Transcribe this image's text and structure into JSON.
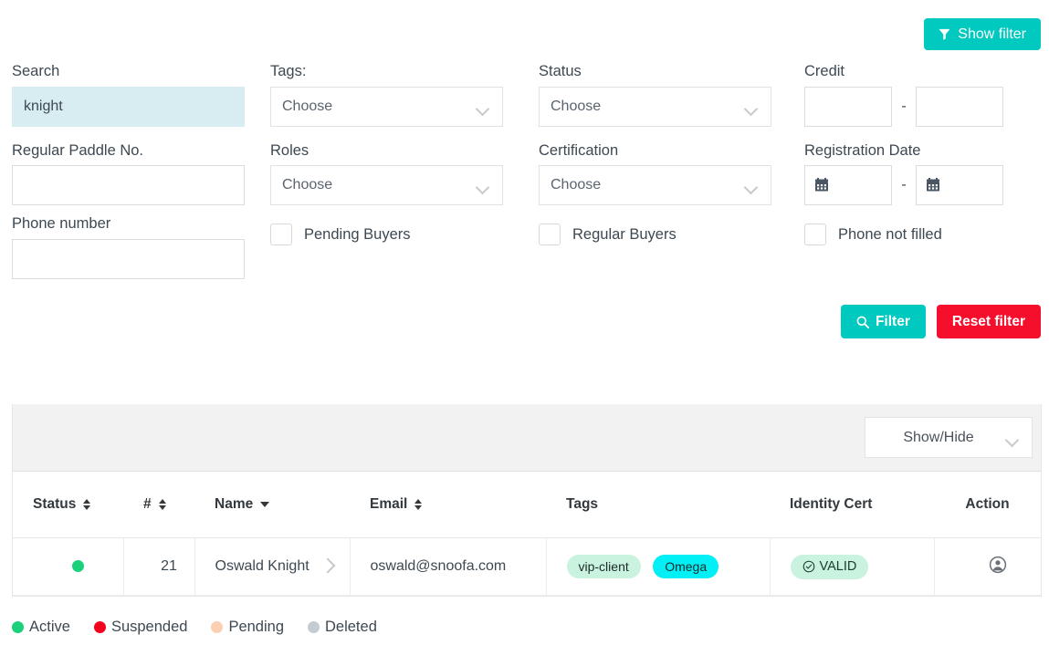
{
  "toolbar": {
    "show_filter_label": "Show filter",
    "show_filter_icon": "funnel-icon",
    "accent_color": "#00c9c0"
  },
  "filters": {
    "search": {
      "label": "Search",
      "value": "knight",
      "placeholder": ""
    },
    "tags": {
      "label": "Tags:",
      "value": "Choose"
    },
    "status": {
      "label": "Status",
      "value": "Choose"
    },
    "credit": {
      "label": "Credit",
      "from": "",
      "to": "",
      "separator": "-"
    },
    "paddle": {
      "label": "Regular Paddle No.",
      "value": "",
      "placeholder": ""
    },
    "roles": {
      "label": "Roles",
      "value": "Choose"
    },
    "certification": {
      "label": "Certification",
      "value": "Choose"
    },
    "registration_date": {
      "label": "Registration Date",
      "from": "",
      "to": "",
      "separator": "-"
    },
    "phone": {
      "label": "Phone number",
      "value": "",
      "placeholder": ""
    },
    "checkboxes": [
      {
        "label": "Pending Buyers",
        "checked": false
      },
      {
        "label": "Regular Buyers",
        "checked": false
      },
      {
        "label": "Phone not filled",
        "checked": false
      }
    ],
    "filter_button": {
      "label": "Filter",
      "icon": "search-icon",
      "color": "#00c9c0"
    },
    "reset_button": {
      "label": "Reset filter",
      "color": "#f50f2c"
    }
  },
  "table": {
    "show_hide_label": "Show/Hide",
    "columns": [
      {
        "label": "Status",
        "sort": "both"
      },
      {
        "label": "#",
        "sort": "both"
      },
      {
        "label": "Name",
        "sort": "desc"
      },
      {
        "label": "Email",
        "sort": "both"
      },
      {
        "label": "Tags",
        "sort": "none"
      },
      {
        "label": "Identity Cert",
        "sort": "none"
      },
      {
        "label": "Action",
        "sort": "none"
      }
    ],
    "rows": [
      {
        "status_color": "#1bd07a",
        "status_name": "Active",
        "number": "21",
        "name": "Oswald Knight",
        "email": "oswald@snoofa.com",
        "tags": [
          {
            "label": "vip-client",
            "bg": "#c9f2df"
          },
          {
            "label": "Omega",
            "bg": "#00f0f5"
          }
        ],
        "identity_cert": {
          "label": "VALID",
          "icon": "check-circle-icon",
          "bg": "#c9f2df"
        },
        "action_icon": "user-circle-icon"
      }
    ]
  },
  "legend": [
    {
      "label": "Active",
      "color": "#1bd07a"
    },
    {
      "label": "Suspended",
      "color": "#f5001e"
    },
    {
      "label": "Pending",
      "color": "#fbcfb2"
    },
    {
      "label": "Deleted",
      "color": "#c5cbd2"
    }
  ]
}
